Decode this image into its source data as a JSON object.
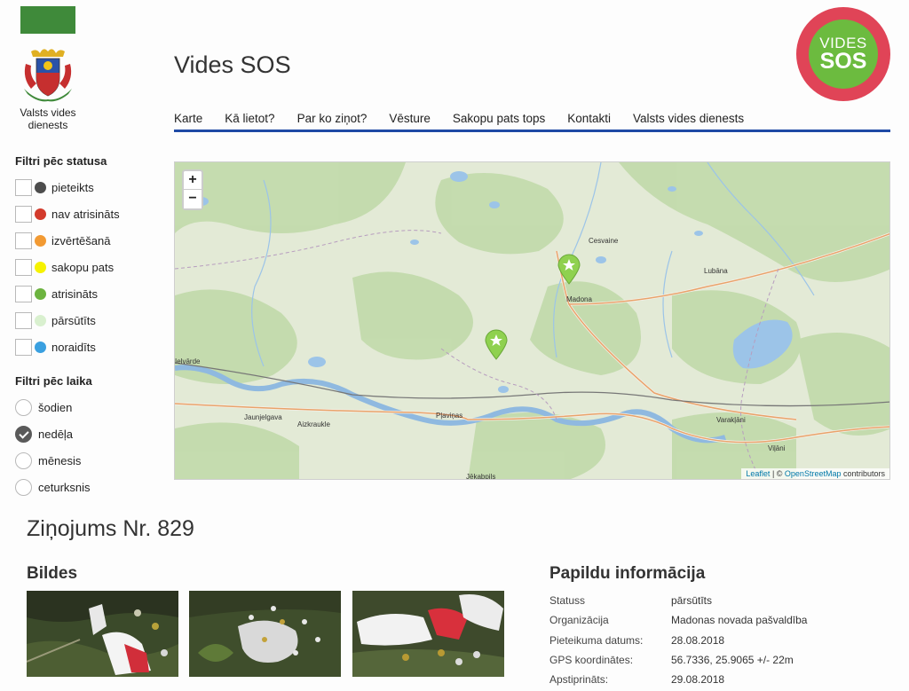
{
  "header": {
    "org_name": "Valsts vides dienests",
    "site_title": "Vides SOS",
    "logo_line1": "VIDES",
    "logo_line2": "SOS"
  },
  "nav": [
    "Karte",
    "Kā lietot?",
    "Par ko ziņot?",
    "Vēsture",
    "Sakopu pats tops",
    "Kontakti",
    "Valsts vides dienests"
  ],
  "filters": {
    "status_title": "Filtri pēc statusa",
    "status": [
      {
        "label": "pieteikts",
        "color": "#4d4d4d"
      },
      {
        "label": "nav atrisināts",
        "color": "#d33b2c"
      },
      {
        "label": "izvērtēšanā",
        "color": "#f29a33"
      },
      {
        "label": "sakopu pats",
        "color": "#f6f200"
      },
      {
        "label": "atrisināts",
        "color": "#6cb33f"
      },
      {
        "label": "pārsūtīts",
        "color": "#d9f0cf"
      },
      {
        "label": "noraidīts",
        "color": "#3aa0e0"
      }
    ],
    "time_title": "Filtri pēc laika",
    "time": [
      {
        "label": "šodien",
        "checked": false
      },
      {
        "label": "nedēļa",
        "checked": true
      },
      {
        "label": "mēnesis",
        "checked": false
      },
      {
        "label": "ceturksnis",
        "checked": false
      }
    ]
  },
  "map": {
    "zoom_in": "+",
    "zoom_out": "−",
    "attribution_leaflet": "Leaflet",
    "attribution_sep": " | © ",
    "attribution_osm": "OpenStreetMap",
    "attribution_rest": " contributors",
    "places": [
      "Cesvaine",
      "Madona",
      "Lubāna",
      "Ielvārde",
      "Jaunjelgava",
      "Aizkraukle",
      "Pļaviņas",
      "Varakļāni",
      "Viļāni",
      "Jēkabpils"
    ],
    "marker_color": "#8fd14f"
  },
  "report": {
    "title": "Ziņojums Nr. 829",
    "photos_title": "Bildes",
    "info_title": "Papildu informācija",
    "info": [
      {
        "k": "Statuss",
        "v": "pārsūtīts"
      },
      {
        "k": "Organizācija",
        "v": "Madonas novada pašvaldība"
      },
      {
        "k": "Pieteikuma datums:",
        "v": "28.08.2018"
      },
      {
        "k": "GPS koordinātes:",
        "v": "56.7336, 25.9065 +/- 22m"
      },
      {
        "k": "Apstiprināts:",
        "v": "29.08.2018"
      }
    ]
  }
}
